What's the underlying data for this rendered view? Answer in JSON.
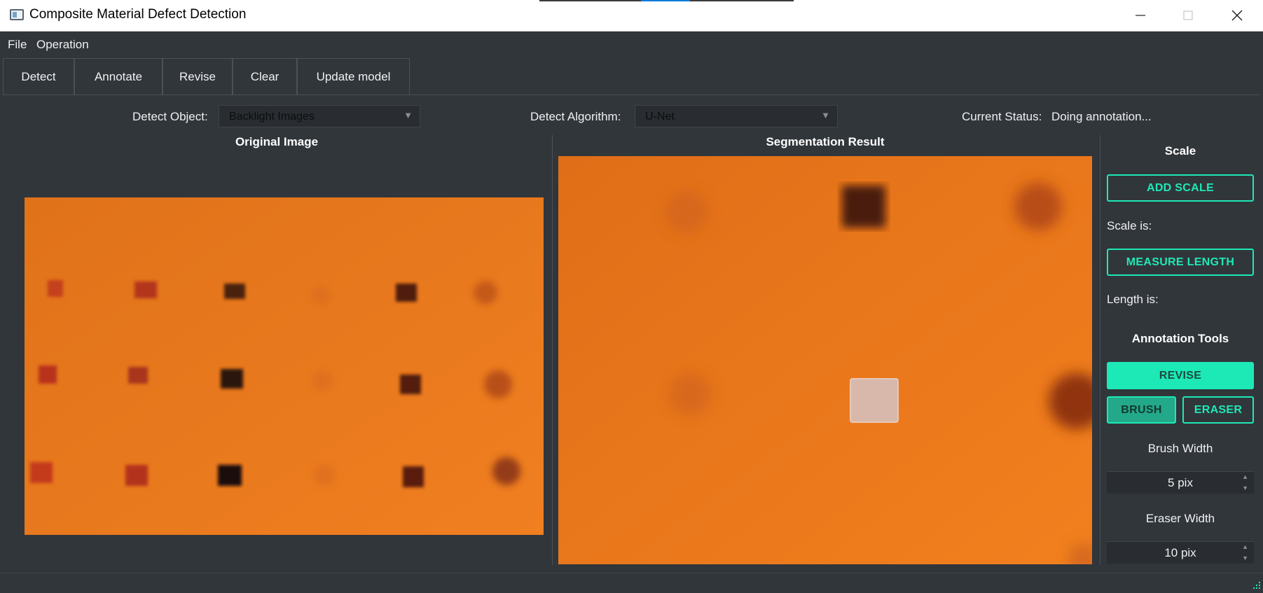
{
  "window": {
    "title": "Composite Material Defect Detection"
  },
  "menu": [
    "File",
    "Operation"
  ],
  "toolbar": {
    "detect": "Detect",
    "annotate": "Annotate",
    "revise": "Revise",
    "clear": "Clear",
    "update_model": "Update model"
  },
  "controls": {
    "detect_object_label": "Detect Object:",
    "detect_object_value": "Backlight Images",
    "detect_algorithm_label": "Detect Algorithm:",
    "detect_algorithm_value": "U-Net",
    "status_label": "Current Status:",
    "status_value": "Doing annotation..."
  },
  "panes": {
    "original_title": "Original Image",
    "segmentation_title": "Segmentation Result"
  },
  "right_panel": {
    "scale_header": "Scale",
    "add_scale": "ADD SCALE",
    "scale_is": "Scale is:",
    "measure_length": "MEASURE LENGTH",
    "length_is": "Length is:",
    "annotation_header": "Annotation Tools",
    "revise": "REVISE",
    "brush": "BRUSH",
    "eraser": "ERASER",
    "brush_width_label": "Brush Width",
    "brush_width_value": "5 pix",
    "eraser_width_label": "Eraser Width",
    "eraser_width_value": "10 pix"
  },
  "colors": {
    "background": "#31363b",
    "accent": "#1de9b6",
    "sample_orange": "#e87b1e"
  }
}
